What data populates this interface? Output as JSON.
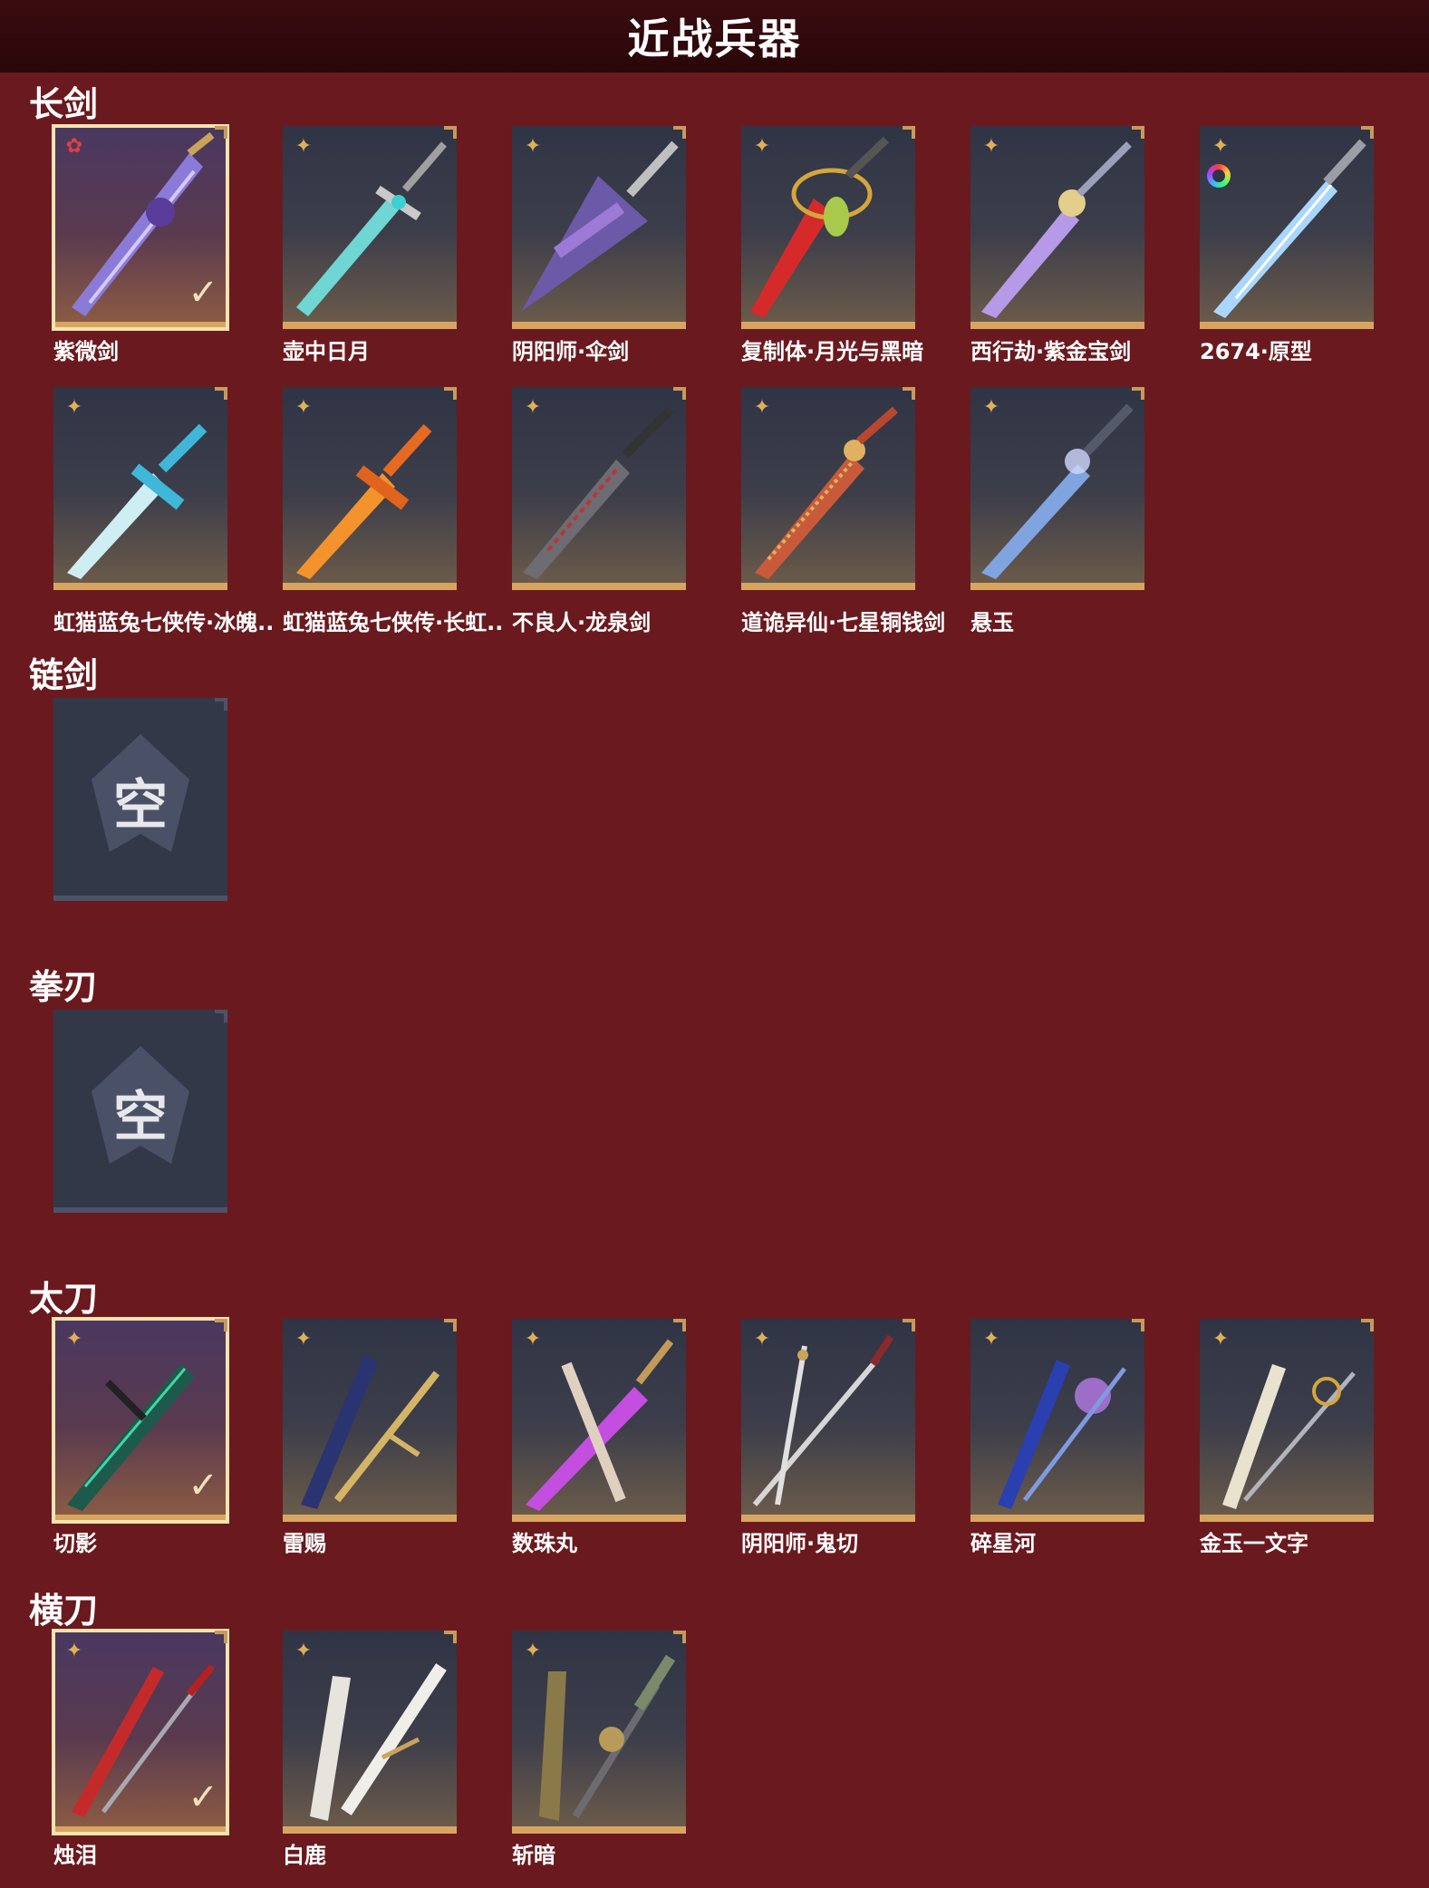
{
  "header": {
    "title": "近战兵器"
  },
  "sections": {
    "changjian": {
      "title": "长剑"
    },
    "lianjian": {
      "title": "链剑",
      "empty_label": "空"
    },
    "quanren": {
      "title": "拳刃",
      "empty_label": "空"
    },
    "taidao": {
      "title": "太刀"
    },
    "hengdao": {
      "title": "横刀"
    }
  },
  "weapons": {
    "changjian": [
      {
        "name": "紫微剑",
        "selected": true,
        "rarity_icon": "red-flower-icon"
      },
      {
        "name": "壶中日月",
        "selected": false,
        "rarity_icon": "gold-flower-icon"
      },
      {
        "name": "阴阳师·伞剑",
        "selected": false,
        "rarity_icon": "gold-flower-icon"
      },
      {
        "name": "复制体·月光与黑暗",
        "selected": false,
        "rarity_icon": "gold-flower-icon"
      },
      {
        "name": "西行劫·紫金宝剑",
        "selected": false,
        "rarity_icon": "gold-flower-icon"
      },
      {
        "name": "2674·原型",
        "selected": false,
        "rarity_icon": "gold-flower-icon",
        "extra_icon": "color-ring-icon"
      },
      {
        "name": "虹猫蓝兔七侠传·冰魄..",
        "selected": false,
        "rarity_icon": "gold-flower-icon"
      },
      {
        "name": "虹猫蓝兔七侠传·长虹..",
        "selected": false,
        "rarity_icon": "gold-flower-icon"
      },
      {
        "name": "不良人·龙泉剑",
        "selected": false,
        "rarity_icon": "gold-flower-icon"
      },
      {
        "name": "道诡异仙·七星铜钱剑",
        "selected": false,
        "rarity_icon": "gold-flower-icon"
      },
      {
        "name": "悬玉",
        "selected": false,
        "rarity_icon": "gold-flower-icon"
      }
    ],
    "taidao": [
      {
        "name": "切影",
        "selected": true,
        "rarity_icon": "gold-flower-icon"
      },
      {
        "name": "雷赐",
        "selected": false,
        "rarity_icon": "gold-flower-icon"
      },
      {
        "name": "数珠丸",
        "selected": false,
        "rarity_icon": "gold-flower-icon"
      },
      {
        "name": "阴阳师·鬼切",
        "selected": false,
        "rarity_icon": "gold-flower-icon"
      },
      {
        "name": "碎星河",
        "selected": false,
        "rarity_icon": "gold-flower-icon"
      },
      {
        "name": "金玉一文字",
        "selected": false,
        "rarity_icon": "gold-flower-icon"
      }
    ],
    "hengdao": [
      {
        "name": "烛泪",
        "selected": true,
        "rarity_icon": "gold-flower-icon"
      },
      {
        "name": "白鹿",
        "selected": false,
        "rarity_icon": "gold-flower-icon"
      },
      {
        "name": "斩暗",
        "selected": false,
        "rarity_icon": "gold-flower-icon"
      }
    ]
  },
  "colors": {
    "background": "#6a1a1f",
    "header": "#2a070a",
    "card_border_gold": "#d8a560",
    "selected_outline": "#f6e3b0"
  }
}
